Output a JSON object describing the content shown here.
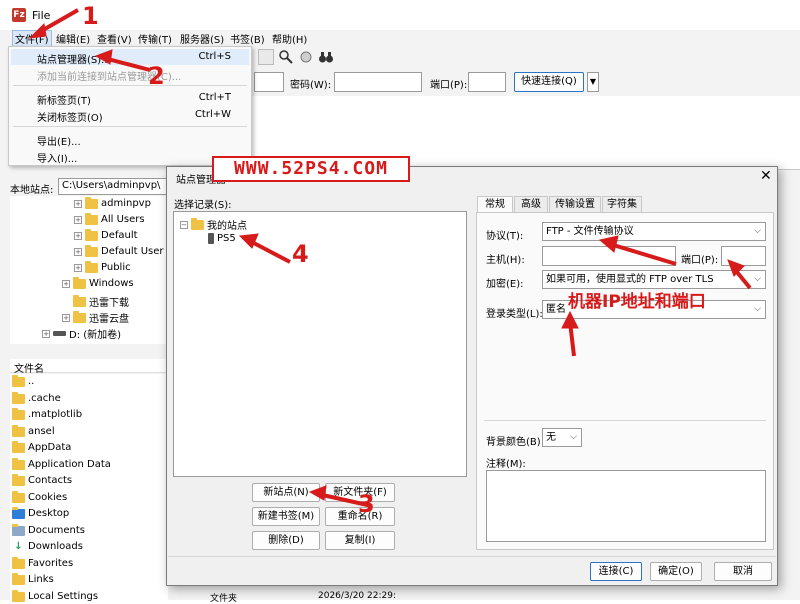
{
  "app": {
    "title": "File"
  },
  "menubar": {
    "items": [
      "文件(F)",
      "编辑(E)",
      "查看(V)",
      "传输(T)",
      "服务器(S)",
      "书签(B)",
      "帮助(H)"
    ]
  },
  "file_menu": {
    "site_manager": {
      "label": "站点管理器(S)...",
      "shortcut": "Ctrl+S"
    },
    "add_current": {
      "label": "添加当前连接到站点管理器(C)..."
    },
    "new_tab": {
      "label": "新标签页(T)",
      "shortcut": "Ctrl+T"
    },
    "close_tab": {
      "label": "关闭标签页(O)",
      "shortcut": "Ctrl+W"
    },
    "export": {
      "label": "导出(E)..."
    },
    "import": {
      "label": "导入(I)..."
    }
  },
  "quickconnect": {
    "password_label": "密码(W):",
    "port_label": "端口(P):",
    "button": "快速连接(Q)"
  },
  "local": {
    "label": "本地站点:",
    "path": "C:\\Users\\adminpvp\\"
  },
  "tree": {
    "items": [
      "adminpvp",
      "All Users",
      "Default",
      "Default User",
      "Public",
      "Windows",
      "迅雷下载",
      "迅雷云盘",
      "D: (新加卷)"
    ]
  },
  "files": {
    "header_name": "文件名",
    "items": [
      "..",
      ".cache",
      ".matplotlib",
      "ansel",
      "AppData",
      "Application Data",
      "Contacts",
      "Cookies",
      "Desktop",
      "Documents",
      "Downloads",
      "Favorites",
      "Links",
      "Local Settings"
    ],
    "last_row_type": "文件夹",
    "last_row_date": "2026/3/20 22:29:"
  },
  "dialog": {
    "title": "站点管理器",
    "select_label": "选择记录(S):",
    "root": "我的站点",
    "site": "PS5",
    "buttons": {
      "new_site": "新站点(N)",
      "new_folder": "新文件夹(F)",
      "new_bookmark": "新建书签(M)",
      "rename": "重命名(R)",
      "delete": "删除(D)",
      "copy": "复制(I)"
    },
    "tabs": [
      "常规",
      "高级",
      "传输设置",
      "字符集"
    ],
    "form": {
      "protocol_label": "协议(T):",
      "protocol_value": "FTP - 文件传输协议",
      "host_label": "主机(H):",
      "port_label": "端口(P):",
      "encryption_label": "加密(E):",
      "encryption_value": "如果可用，使用显式的 FTP over TLS",
      "logon_label": "登录类型(L):",
      "logon_value": "匿名",
      "bg_label": "背景颜色(B)",
      "bg_value": "无",
      "comment_label": "注释(M):"
    },
    "footer": {
      "connect": "连接(C)",
      "ok": "确定(O)",
      "cancel": "取消"
    }
  },
  "annotations": {
    "watermark": "WWW.52PS4.COM",
    "n1": "1",
    "n2": "2",
    "n3": "3",
    "n4": "4",
    "ip_port": "机器IP地址和端口"
  },
  "colors": {
    "annotation_red": "#d71a1a",
    "folder_yellow": "#f0c243",
    "primary_border": "#2a73c5"
  }
}
